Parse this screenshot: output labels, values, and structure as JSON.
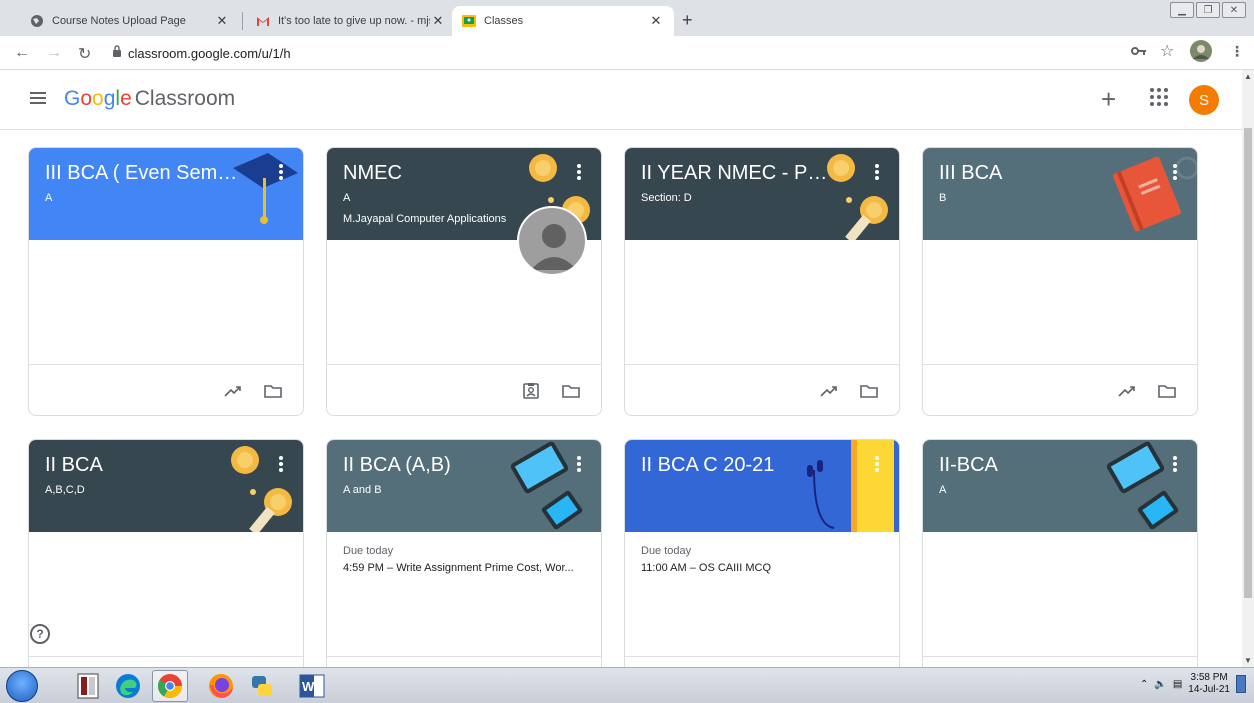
{
  "browser": {
    "tabs": [
      {
        "title": "Course Notes Upload Page"
      },
      {
        "title": "It's too late to give up now. - mjssal"
      },
      {
        "title": "Classes"
      }
    ],
    "new_tab": "+",
    "address": "classroom.google.com/u/1/h"
  },
  "app": {
    "logo_google": [
      "G",
      "o",
      "o",
      "g",
      "l",
      "e"
    ],
    "logo_google_colors": [
      "#4285f4",
      "#ea4335",
      "#fbbc05",
      "#4285f4",
      "#34a853",
      "#ea4335"
    ],
    "logo_product": "Classroom",
    "plus": "+",
    "account_initial": "S"
  },
  "colors": {
    "blue_banner": "#4285f4",
    "dark_banner": "#37474f",
    "slate_banner": "#546e7a",
    "royal_banner": "#3367d6",
    "account": "#f57c00"
  },
  "classes": [
    {
      "title": "III BCA ( Even Semest...",
      "section": "A",
      "teacher": "",
      "banner": "blue_banner",
      "art": "cap",
      "due_label": "",
      "due_item": "",
      "footer_icons": [
        "trending-up-icon",
        "folder-icon"
      ]
    },
    {
      "title": "NMEC",
      "section": "A",
      "teacher": "M.Jayapal Computer Applications",
      "banner": "dark_banner",
      "art": "coins",
      "due_label": "",
      "due_item": "",
      "footer_icons": [
        "assigned-work-icon",
        "folder-icon"
      ]
    },
    {
      "title": "II YEAR NMEC - PRIN...",
      "section": "Section: D",
      "teacher": "",
      "banner": "dark_banner",
      "art": "coins",
      "due_label": "",
      "due_item": "",
      "footer_icons": [
        "trending-up-icon",
        "folder-icon"
      ]
    },
    {
      "title": "III BCA",
      "section": "B",
      "teacher": "",
      "banner": "slate_banner",
      "art": "book",
      "due_label": "",
      "due_item": "",
      "footer_icons": [
        "trending-up-icon",
        "folder-icon"
      ]
    },
    {
      "title": "II BCA",
      "section": "A,B,C,D",
      "teacher": "",
      "banner": "dark_banner",
      "art": "coins",
      "due_label": "",
      "due_item": "",
      "footer_icons": []
    },
    {
      "title": "II BCA (A,B)",
      "section": "A and B",
      "teacher": "",
      "banner": "slate_banner",
      "art": "tablet",
      "due_label": "Due today",
      "due_item": "4:59 PM – Write Assignment Prime Cost, Wor...",
      "footer_icons": []
    },
    {
      "title": "II BCA C 20-21",
      "section": "",
      "teacher": "",
      "banner": "royal_banner",
      "art": "headphones",
      "due_label": "Due today",
      "due_item": "11:00 AM – OS CAIII MCQ",
      "footer_icons": []
    },
    {
      "title": "II-BCA",
      "section": "A",
      "teacher": "",
      "banner": "slate_banner",
      "art": "tablet",
      "due_label": "",
      "due_item": "",
      "footer_icons": []
    }
  ],
  "help": "?",
  "taskbar": {
    "apps": [
      "tally-erp9",
      "edge",
      "chrome",
      "firefox",
      "python",
      "word"
    ],
    "time": "3:58 PM",
    "date": "14-Jul-21"
  }
}
